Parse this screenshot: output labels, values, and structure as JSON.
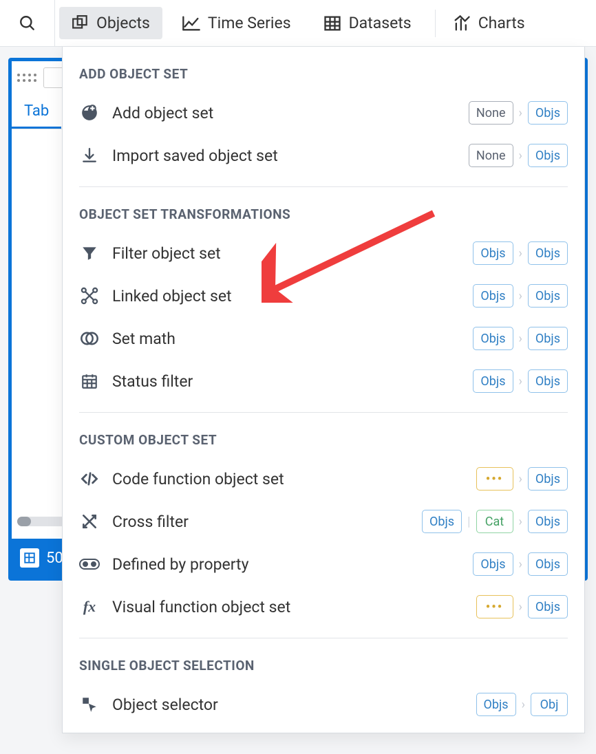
{
  "toolbar": {
    "tabs": {
      "objects": "Objects",
      "time_series": "Time Series",
      "datasets": "Datasets",
      "charts": "Charts"
    }
  },
  "card": {
    "tab_label": "Tab",
    "footer_count": "50"
  },
  "pills": {
    "none": "None",
    "objs": "Objs",
    "obj": "Obj",
    "cat": "Cat",
    "dots": "•••"
  },
  "dropdown": {
    "sections": {
      "add_object_set": {
        "title": "ADD OBJECT SET",
        "items": {
          "add": "Add object set",
          "import": "Import saved object set"
        }
      },
      "transformations": {
        "title": "OBJECT SET TRANSFORMATIONS",
        "items": {
          "filter": "Filter object set",
          "linked": "Linked object set",
          "set_math": "Set math",
          "status_filter": "Status filter"
        }
      },
      "custom": {
        "title": "CUSTOM OBJECT SET",
        "items": {
          "code_function": "Code function object set",
          "cross_filter": "Cross filter",
          "defined_by_property": "Defined by property",
          "visual_function": "Visual function object set"
        }
      },
      "single": {
        "title": "SINGLE OBJECT SELECTION",
        "items": {
          "object_selector": "Object selector"
        }
      }
    }
  }
}
